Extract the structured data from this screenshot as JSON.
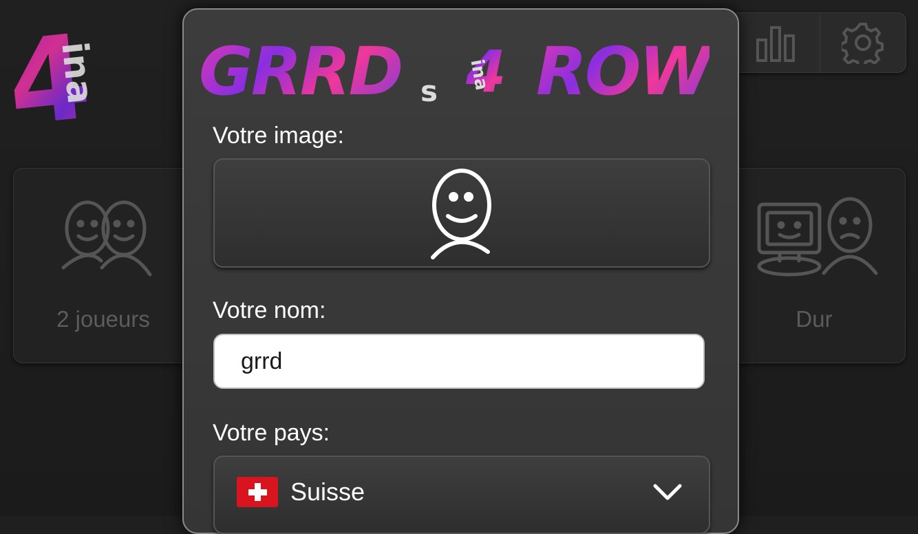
{
  "background": {
    "logo_text": "4",
    "logo_sub": "ina",
    "modes": [
      {
        "label": "2 joueurs",
        "icon": "two-players-icon"
      },
      {
        "label": "Dur",
        "icon": "computer-vs-player-icon"
      }
    ],
    "toolbar": {
      "stats_icon": "bar-chart-icon",
      "settings_icon": "gear-icon"
    }
  },
  "modal": {
    "title_main_left": "GRRD",
    "title_sub_s": "s",
    "title_four": "4",
    "title_ina": "ina",
    "title_main_right": "ROW",
    "image_label": "Votre image:",
    "avatar_icon": "smiley-person-icon",
    "name_label": "Votre nom:",
    "name_value": "grrd",
    "country_label": "Votre pays:",
    "country_value": "Suisse",
    "country_flag": "swiss-flag-icon",
    "dropdown_icon": "chevron-down-icon"
  },
  "colors": {
    "background": "#1f1f1f",
    "modal_bg": "#3a3a3a",
    "title_pink": "#e03ab0",
    "title_purple": "#8a2ee0",
    "swiss_red": "#d8141e"
  }
}
